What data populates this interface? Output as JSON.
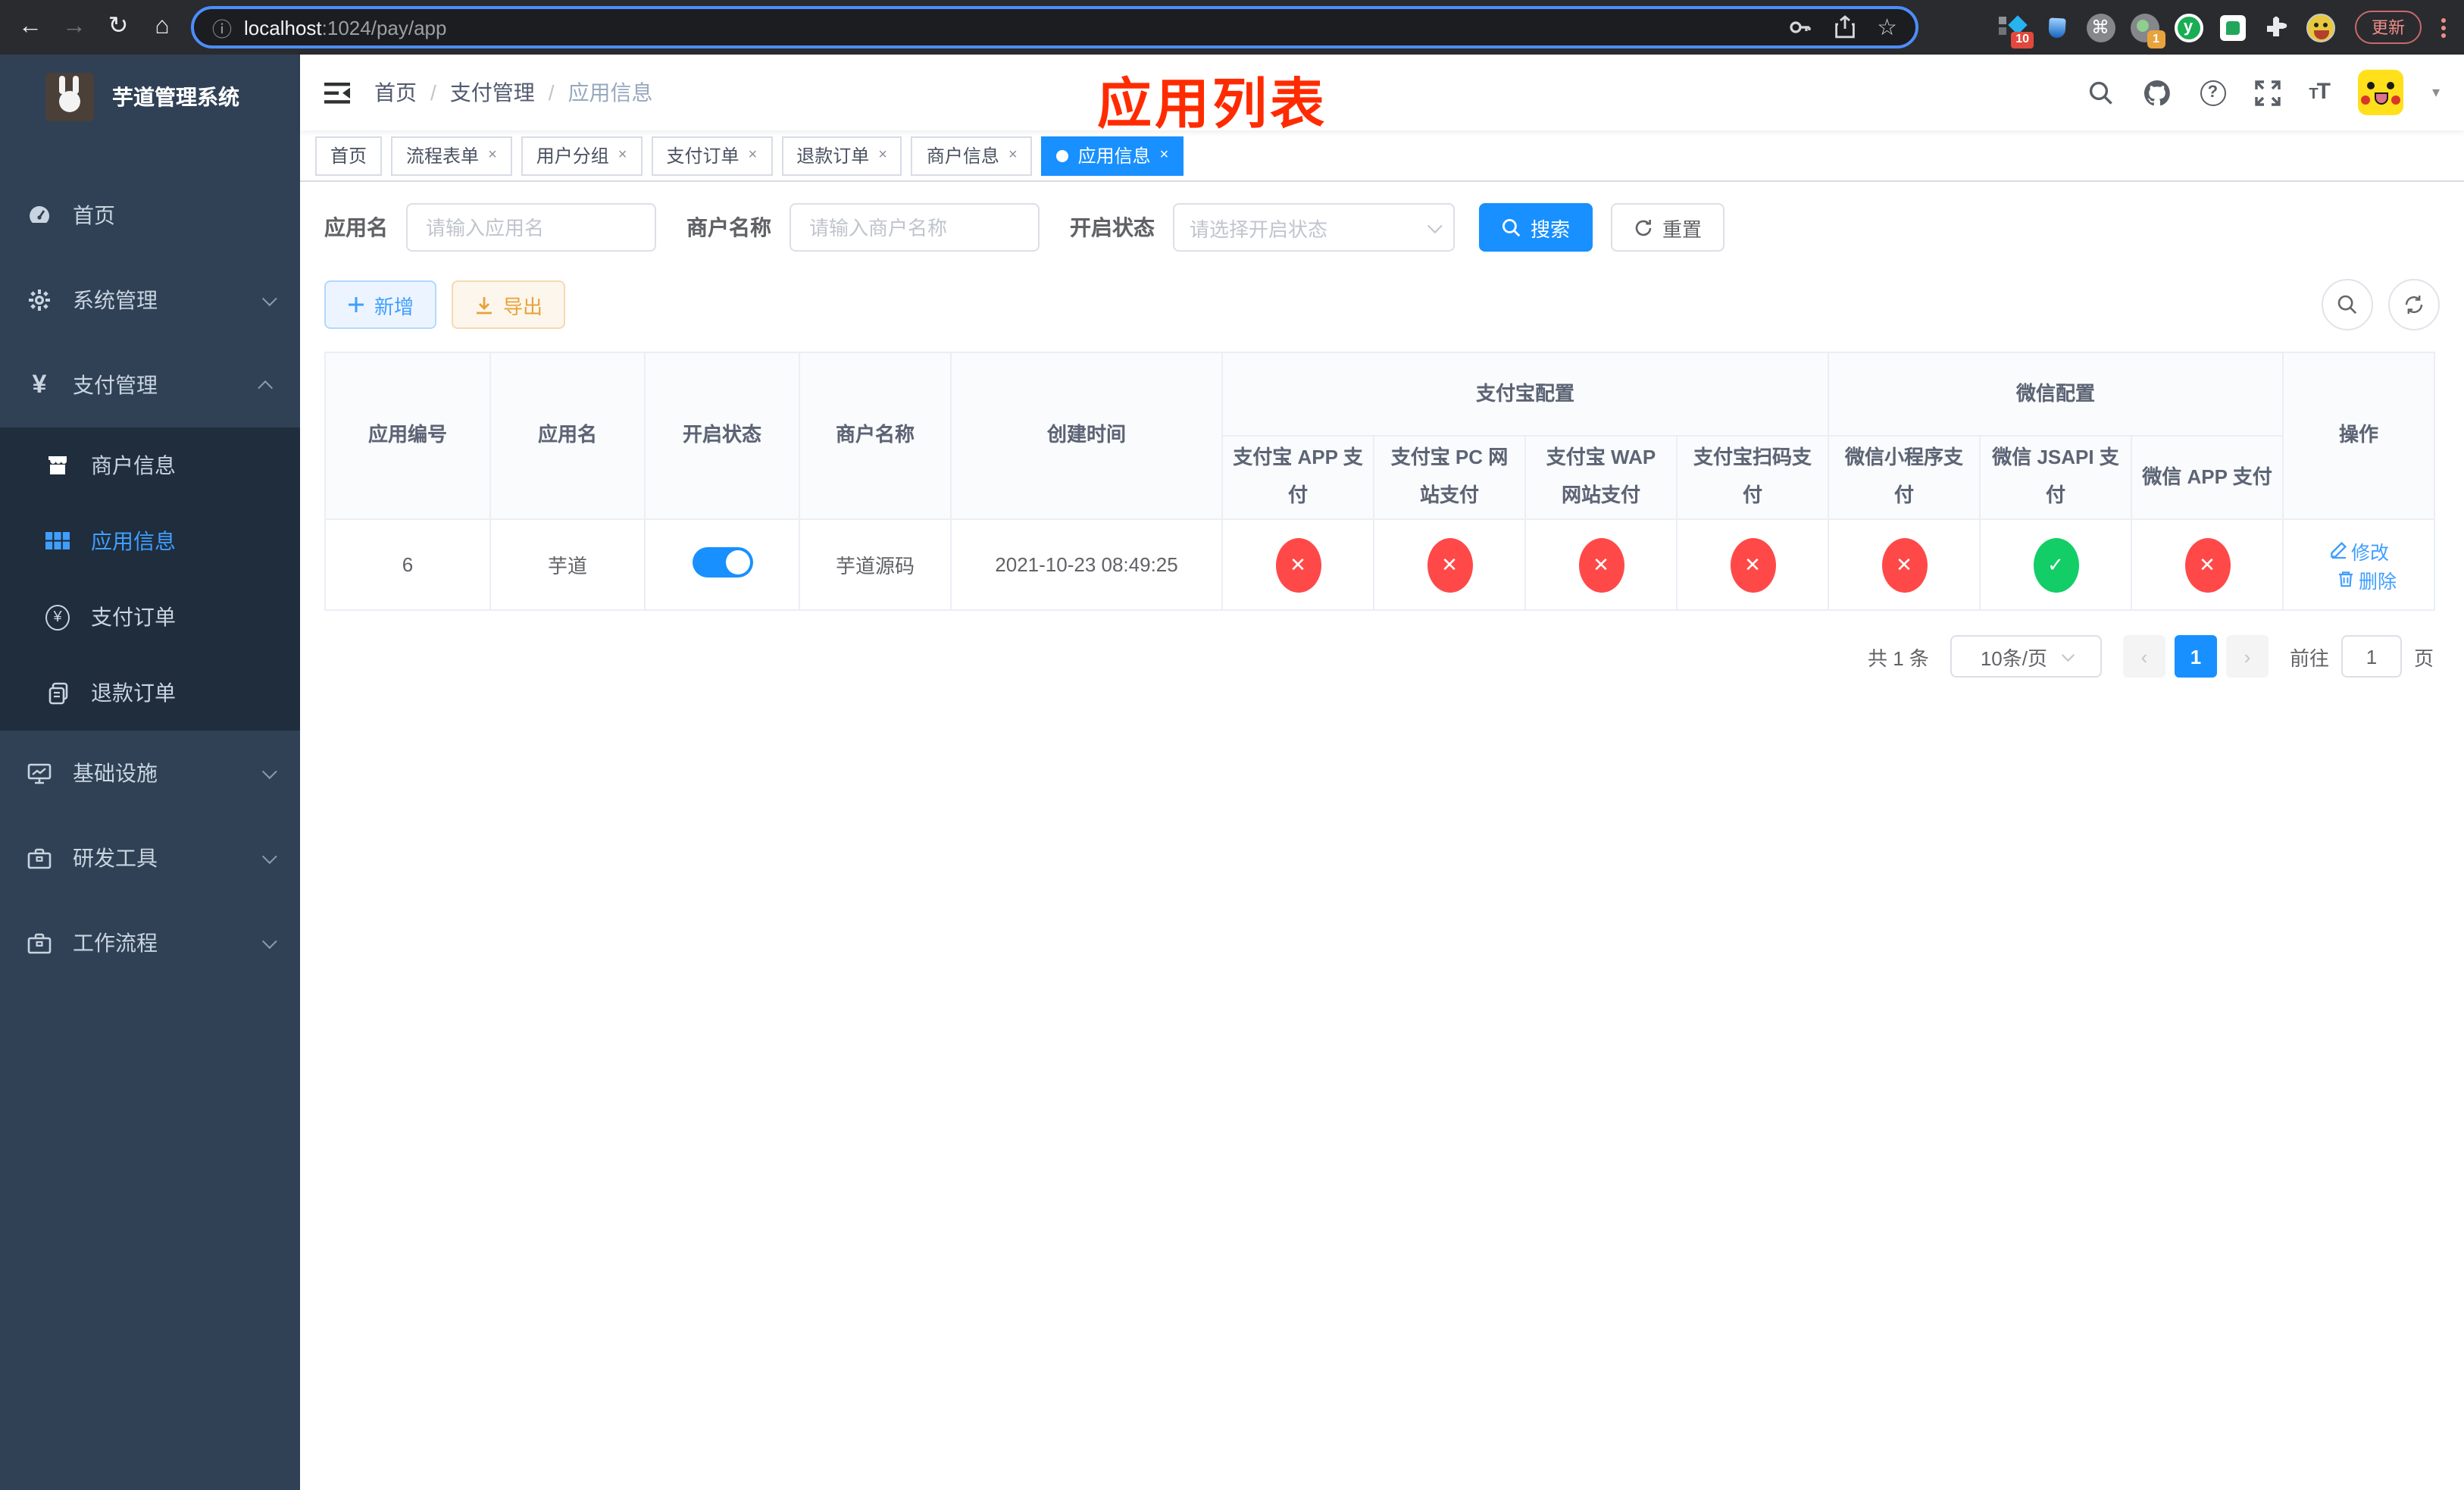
{
  "browser": {
    "host": "localhost",
    "path": ":1024/pay/app",
    "ext_badge_10": "10",
    "ext_badge_1": "1",
    "ext_y": "y",
    "command_glyph": "⌘",
    "update_button": "更新"
  },
  "annotation": {
    "title": "应用列表"
  },
  "sidebar": {
    "title": "芋道管理系统",
    "items": [
      {
        "label": "首页"
      },
      {
        "label": "系统管理"
      },
      {
        "label": "支付管理"
      },
      {
        "label": "基础设施"
      },
      {
        "label": "研发工具"
      },
      {
        "label": "工作流程"
      }
    ],
    "sub_items": [
      {
        "label": "商户信息"
      },
      {
        "label": "应用信息"
      },
      {
        "label": "支付订单"
      },
      {
        "label": "退款订单"
      }
    ],
    "yen": "¥"
  },
  "breadcrumb": {
    "items": [
      "首页",
      "支付管理",
      "应用信息"
    ],
    "separator": "/"
  },
  "tabs": [
    {
      "label": "首页"
    },
    {
      "label": "流程表单",
      "close": "×"
    },
    {
      "label": "用户分组",
      "close": "×"
    },
    {
      "label": "支付订单",
      "close": "×"
    },
    {
      "label": "退款订单",
      "close": "×"
    },
    {
      "label": "商户信息",
      "close": "×"
    },
    {
      "label": "应用信息",
      "close": "×"
    }
  ],
  "filters": {
    "app_name_label": "应用名",
    "app_name_placeholder": "请输入应用名",
    "merchant_label": "商户名称",
    "merchant_placeholder": "请输入商户名称",
    "status_label": "开启状态",
    "status_placeholder": "请选择开启状态",
    "search_button": "搜索",
    "reset_button": "重置"
  },
  "toolbar": {
    "add_button": "新增",
    "export_button": "导出"
  },
  "table": {
    "columns": {
      "app_id": "应用编号",
      "app_name": "应用名",
      "status": "开启状态",
      "merchant": "商户名称",
      "created": "创建时间",
      "alipay_group": "支付宝配置",
      "wechat_group": "微信配置",
      "alipay_app": "支付宝 APP 支付",
      "alipay_pc": "支付宝 PC 网站支付",
      "alipay_wap": "支付宝 WAP 网站支付",
      "alipay_qr": "支付宝扫码支付",
      "wx_mini": "微信小程序支付",
      "wx_jsapi": "微信 JSAPI 支付",
      "wx_app": "微信 APP 支付",
      "operation": "操作"
    },
    "row": {
      "app_id": "6",
      "app_name": "芋道",
      "merchant": "芋道源码",
      "created": "2021-10-23 08:49:25",
      "edit": "修改",
      "delete": "删除"
    },
    "glyphs": {
      "cross": "✕",
      "check": "✓"
    }
  },
  "pagination": {
    "total": "共 1 条",
    "per_page": "10条/页",
    "prev": "‹",
    "page": "1",
    "next": "›",
    "goto": "前往",
    "goto_value": "1",
    "page_unit": "页"
  }
}
